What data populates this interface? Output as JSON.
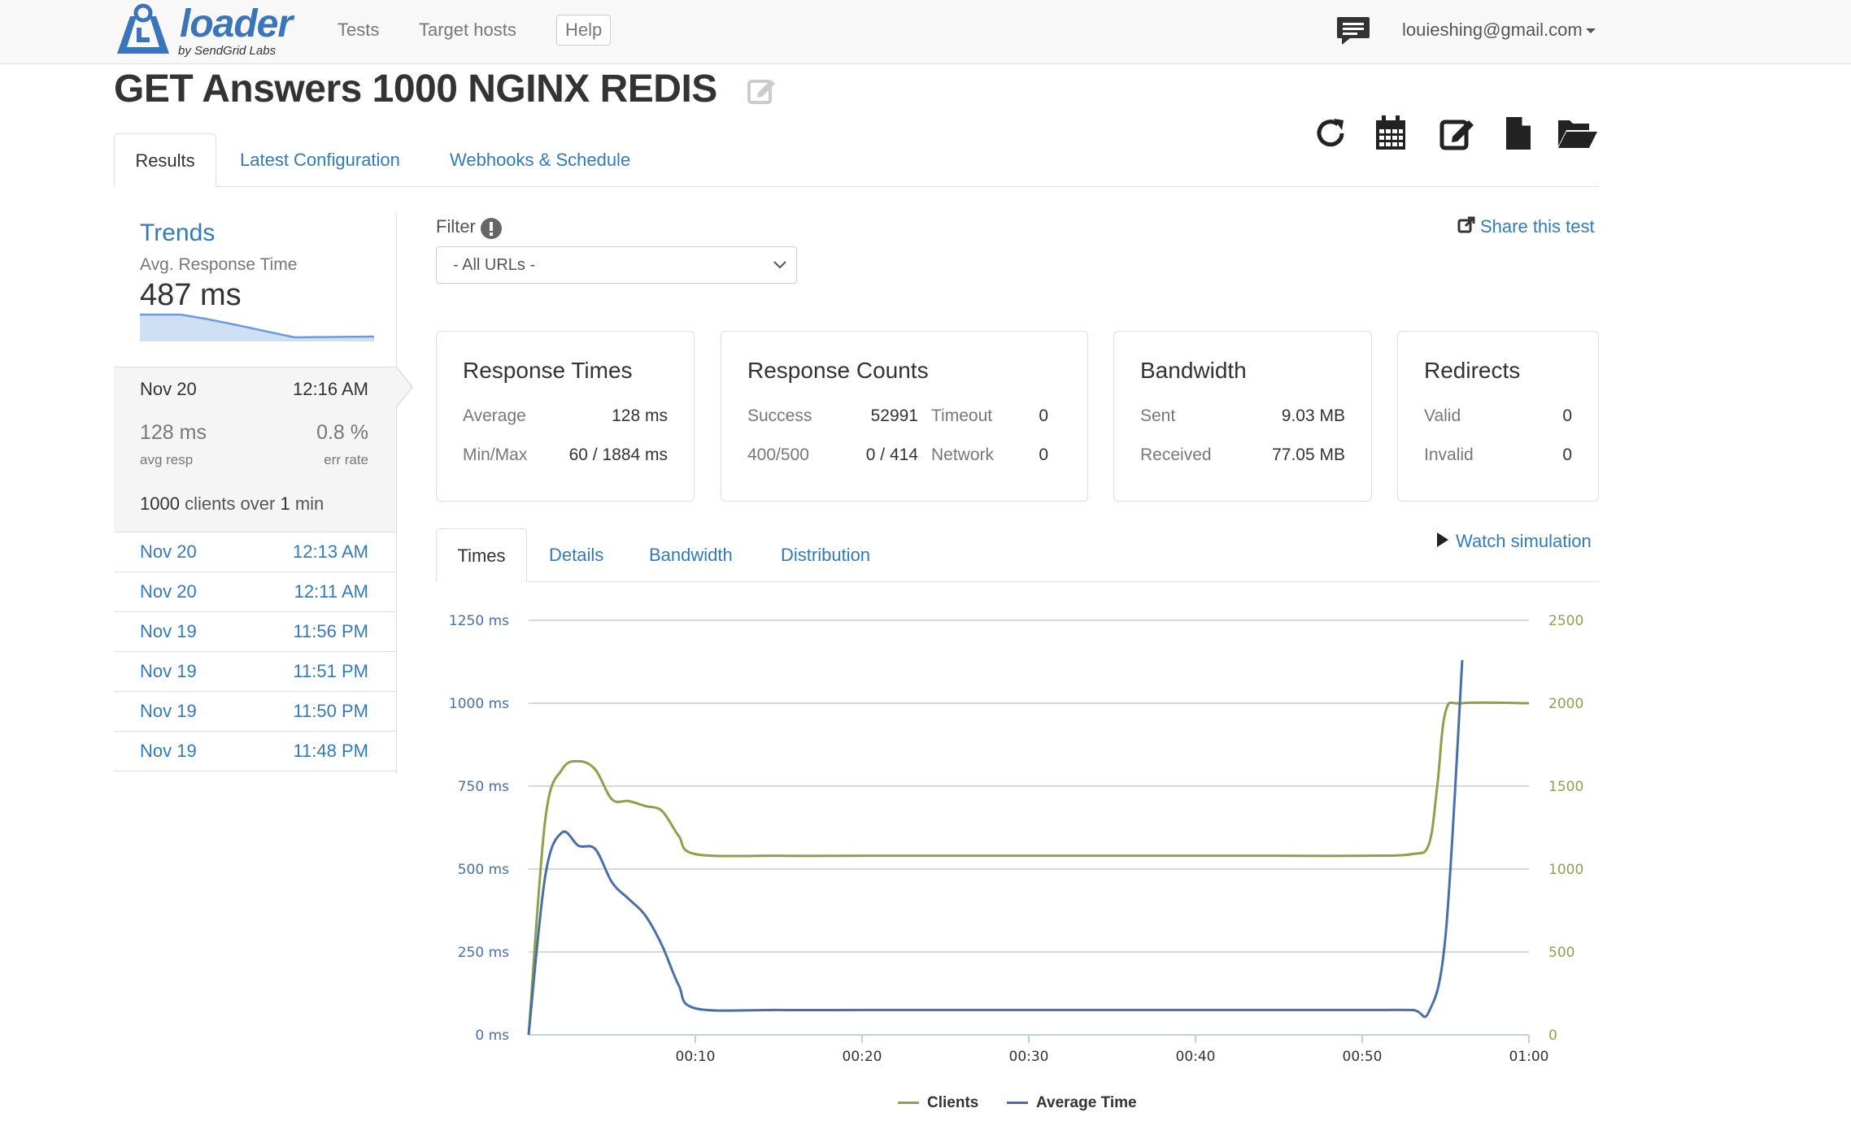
{
  "nav": {
    "logo_text": "loader",
    "logo_sub": "by SendGrid Labs",
    "links": [
      "Tests",
      "Target hosts"
    ],
    "help": "Help",
    "user_email": "louieshing@gmail.com",
    "icons": [
      "chat-icon"
    ]
  },
  "page": {
    "title": "GET Answers 1000 NGINX REDIS",
    "toolbar_icons": [
      "refresh-icon",
      "calendar-icon",
      "edit-icon",
      "file-icon",
      "folder-open-icon"
    ]
  },
  "tabs": [
    "Results",
    "Latest Configuration",
    "Webhooks & Schedule"
  ],
  "sidebar": {
    "trends_title": "Trends",
    "avg_label": "Avg. Response Time",
    "avg_value": "487 ms",
    "current_run": {
      "date": "Nov 20",
      "time": "12:16 AM",
      "avg_resp": "128 ms",
      "avg_resp_label": "avg resp",
      "err_rate": "0.8 %",
      "err_rate_label": "err rate",
      "clients": "1000",
      "clients_mid": " clients over ",
      "duration": "1",
      "duration_unit": " min"
    },
    "runs": [
      {
        "date": "Nov 20",
        "time": "12:13 AM"
      },
      {
        "date": "Nov 20",
        "time": "12:11 AM"
      },
      {
        "date": "Nov 19",
        "time": "11:56 PM"
      },
      {
        "date": "Nov 19",
        "time": "11:51 PM"
      },
      {
        "date": "Nov 19",
        "time": "11:50 PM"
      },
      {
        "date": "Nov 19",
        "time": "11:48 PM"
      }
    ]
  },
  "filter": {
    "label": "Filter",
    "selected": "- All URLs -"
  },
  "share": "Share this test",
  "panels": {
    "response_times": {
      "title": "Response Times",
      "average_label": "Average",
      "average": "128 ms",
      "minmax_label": "Min/Max",
      "minmax": "60 / 1884 ms"
    },
    "response_counts": {
      "title": "Response Counts",
      "success_label": "Success",
      "success": "52991",
      "timeout_label": "Timeout",
      "timeout": "0",
      "err_label": "400/500",
      "err": "0 / 414",
      "network_label": "Network",
      "network": "0"
    },
    "bandwidth": {
      "title": "Bandwidth",
      "sent_label": "Sent",
      "sent": "9.03 MB",
      "received_label": "Received",
      "received": "77.05 MB"
    },
    "redirects": {
      "title": "Redirects",
      "valid_label": "Valid",
      "valid": "0",
      "invalid_label": "Invalid",
      "invalid": "0"
    }
  },
  "chart_tabs": [
    "Times",
    "Details",
    "Bandwidth",
    "Distribution"
  ],
  "watch_simulation": "Watch simulation",
  "colors": {
    "clients": "#8ea04b",
    "avg_time": "#4a6fa5",
    "link": "#337ab7"
  },
  "chart_data": {
    "type": "line",
    "x_ticks": [
      "00:10",
      "00:20",
      "00:30",
      "00:40",
      "00:50",
      "01:00"
    ],
    "y_left_ticks": [
      "0 ms",
      "250 ms",
      "500 ms",
      "750 ms",
      "1000 ms",
      "1250 ms"
    ],
    "y_right_ticks": [
      "0",
      "500",
      "1000",
      "1500",
      "2000",
      "2500"
    ],
    "xlim": [
      0,
      60
    ],
    "ylim_left": [
      0,
      1250
    ],
    "ylim_right": [
      0,
      2500
    ],
    "grid": true,
    "legend_position": "bottom",
    "series": [
      {
        "name": "Clients",
        "axis": "right",
        "x": [
          0,
          1,
          2,
          3,
          4,
          5,
          6,
          7,
          8,
          9,
          10,
          15,
          20,
          25,
          30,
          35,
          40,
          45,
          50,
          53,
          54,
          54.5,
          55,
          56,
          60
        ],
        "y": [
          0,
          1300,
          1600,
          1650,
          1600,
          1420,
          1410,
          1380,
          1350,
          1200,
          1090,
          1080,
          1080,
          1080,
          1080,
          1080,
          1080,
          1080,
          1080,
          1090,
          1150,
          1500,
          1950,
          2000,
          2000
        ]
      },
      {
        "name": "Average Time",
        "axis": "left",
        "x": [
          0,
          1,
          2,
          3,
          4,
          5,
          6,
          7,
          8,
          9,
          10,
          15,
          20,
          25,
          30,
          35,
          40,
          45,
          50,
          53,
          54,
          55,
          56
        ],
        "y": [
          0,
          480,
          610,
          570,
          560,
          460,
          410,
          360,
          270,
          150,
          80,
          75,
          75,
          75,
          75,
          75,
          75,
          75,
          75,
          75,
          70,
          300,
          1130
        ]
      }
    ]
  }
}
